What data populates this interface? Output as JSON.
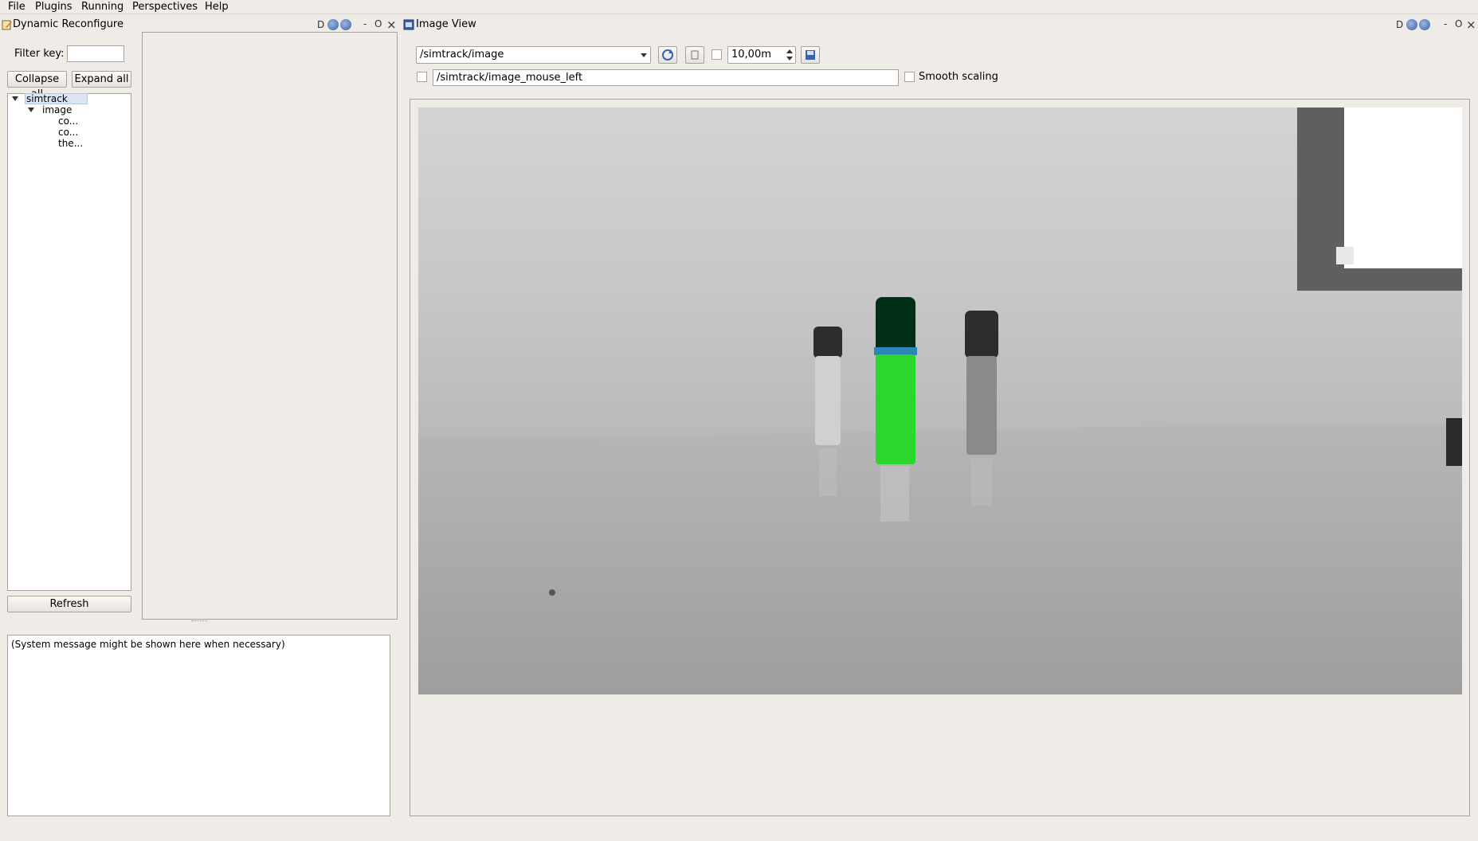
{
  "menubar": {
    "items": [
      {
        "label": "File"
      },
      {
        "label": "Plugins"
      },
      {
        "label": "Running"
      },
      {
        "label": "Perspectives"
      },
      {
        "label": "Help"
      }
    ]
  },
  "left_dock": {
    "title": "Dynamic Reconfigure",
    "header_glyphs": {
      "d": "D",
      "min": "-",
      "float": "O",
      "close": "×"
    },
    "filter_label": "Filter key:",
    "filter_value": "",
    "collapse_label": "Collapse all",
    "expand_label": "Expand all",
    "tree": {
      "root": "simtrack",
      "child": "image",
      "leaves": [
        "co...",
        "co...",
        "the..."
      ]
    },
    "refresh_label": "Refresh",
    "system_message": "(System message might be shown here when necessary)"
  },
  "right_dock": {
    "title": "Image View",
    "header_glyphs": {
      "d": "D",
      "min": "-",
      "float": "O",
      "close": "×"
    },
    "topic_value": "/simtrack/image",
    "zoom_value": "10,00m",
    "mouse_topic_value": "/simtrack/image_mouse_left",
    "smooth_scaling_label": "Smooth scaling"
  },
  "icons": {
    "refresh": "refresh-icon",
    "save": "save-icon",
    "help": "help-icon",
    "window": "window-icon",
    "edit": "edit-icon"
  },
  "colors": {
    "background": "#efebe7",
    "selection": "#dbe6f4",
    "marker_green": "#2dd62d"
  }
}
